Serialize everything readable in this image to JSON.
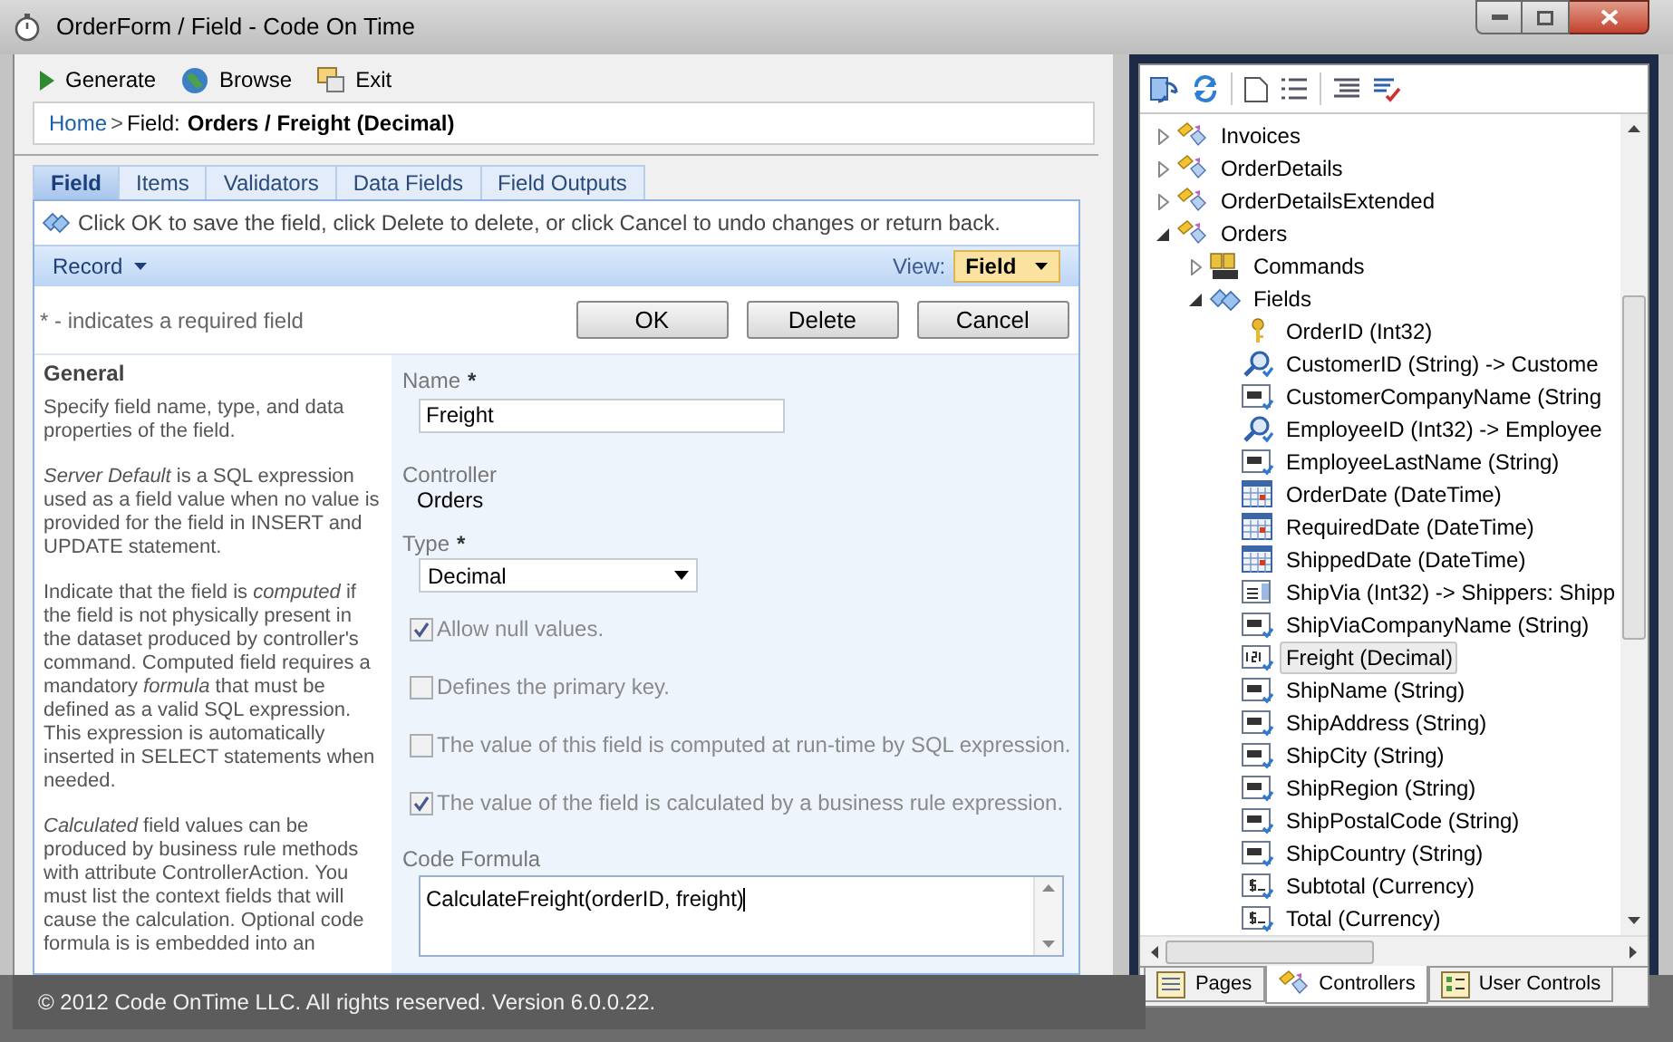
{
  "window": {
    "title": "OrderForm / Field - Code On Time"
  },
  "toolbar": [
    {
      "label": "Generate",
      "kind": "play"
    },
    {
      "label": "Browse",
      "kind": "globe"
    },
    {
      "label": "Exit",
      "kind": "exit"
    }
  ],
  "breadcrumb": {
    "link": "Home",
    "separator": ">",
    "prefix": "Field:",
    "path": "Orders / Freight (Decimal)"
  },
  "tabs": [
    {
      "label": "Field",
      "selected": true
    },
    {
      "label": "Items",
      "selected": false
    },
    {
      "label": "Validators",
      "selected": false
    },
    {
      "label": "Data Fields",
      "selected": false
    },
    {
      "label": "Field Outputs",
      "selected": false
    }
  ],
  "hint": "Click OK to save the field, click Delete to delete, or click Cancel to undo changes or return back.",
  "action_bar": {
    "menu": "Record",
    "view_label": "View:",
    "view": "Field"
  },
  "required_note": "* - indicates a required field",
  "buttons": [
    "OK",
    "Delete",
    "Cancel"
  ],
  "description": {
    "title": "General",
    "paragraphs": [
      "Specify field name, type, and data properties of the field.",
      "*Server Default* is a SQL expression used as a field value when no value is provided for the field in INSERT and UPDATE statement.",
      "Indicate that the field is *computed* if the field is not physically present in the dataset produced by controller's command. Computed field requires a mandatory *formula* that must be defined as a valid SQL expression. This expression is automatically inserted in SELECT statements when needed.",
      "*Calculated* field values can be produced by business rule methods with attribute ControllerAction. You must list the context fields that will cause the calculation. Optional code formula is is embedded into an"
    ]
  },
  "form": [
    {
      "kind": "input",
      "label": "Name",
      "mark": "*",
      "value": "Freight"
    },
    {
      "kind": "static",
      "label": "Controller",
      "value": "Orders"
    },
    {
      "kind": "select",
      "label": "Type",
      "mark": "*",
      "value": "Decimal"
    },
    {
      "kind": "checkbox",
      "label": "Allow null values.",
      "checked": true
    },
    {
      "kind": "checkbox",
      "label": "Defines the primary key.",
      "checked": false
    },
    {
      "kind": "checkbox",
      "label": "The value of this field is computed at run-time by SQL expression.",
      "checked": false
    },
    {
      "kind": "checkbox",
      "label": "The value of the field is calculated by a business rule expression.",
      "checked": true
    },
    {
      "kind": "textarea",
      "label": "Code Formula",
      "value": "CalculateFreight(orderID, freight)"
    }
  ],
  "status_bar": "© 2012 Code OnTime LLC. All rights reserved. Version 6.0.0.22.",
  "tree": [
    {
      "label": "Invoices",
      "kind": "controller",
      "expanded": false
    },
    {
      "label": "OrderDetails",
      "kind": "controller",
      "expanded": false
    },
    {
      "label": "OrderDetailsExtended",
      "kind": "controller",
      "expanded": false
    },
    {
      "label": "Orders",
      "kind": "controller",
      "expanded": true,
      "children": [
        {
          "label": "Commands",
          "kind": "sql",
          "expanded": false
        },
        {
          "label": "Fields",
          "kind": "fields",
          "expanded": true,
          "children": [
            {
              "label": "OrderID (Int32)",
              "kind": "key",
              "selected": false
            },
            {
              "label": "CustomerID (String) -> Custome",
              "kind": "lookup",
              "selected": false
            },
            {
              "label": "CustomerCompanyName (String",
              "kind": "text",
              "selected": false
            },
            {
              "label": "EmployeeID (Int32) -> Employee",
              "kind": "lookup",
              "selected": false
            },
            {
              "label": "EmployeeLastName (String)",
              "kind": "text",
              "selected": false
            },
            {
              "label": "OrderDate (DateTime)",
              "kind": "date",
              "selected": false
            },
            {
              "label": "RequiredDate (DateTime)",
              "kind": "date",
              "selected": false
            },
            {
              "label": "ShippedDate (DateTime)",
              "kind": "date",
              "selected": false
            },
            {
              "label": "ShipVia (Int32) -> Shippers: Shipp",
              "kind": "list",
              "selected": false
            },
            {
              "label": "ShipViaCompanyName (String)",
              "kind": "text",
              "selected": false
            },
            {
              "label": "Freight (Decimal)",
              "kind": "number",
              "selected": true
            },
            {
              "label": "ShipName (String)",
              "kind": "text",
              "selected": false
            },
            {
              "label": "ShipAddress (String)",
              "kind": "text",
              "selected": false
            },
            {
              "label": "ShipCity (String)",
              "kind": "text",
              "selected": false
            },
            {
              "label": "ShipRegion (String)",
              "kind": "text",
              "selected": false
            },
            {
              "label": "ShipPostalCode (String)",
              "kind": "text",
              "selected": false
            },
            {
              "label": "ShipCountry (String)",
              "kind": "text",
              "selected": false
            },
            {
              "label": "Subtotal (Currency)",
              "kind": "currency",
              "selected": false
            },
            {
              "label": "Total (Currency)",
              "kind": "currency",
              "selected": false
            }
          ]
        }
      ]
    }
  ],
  "bottom_tabs": [
    {
      "label": "Pages",
      "kind": "pages",
      "selected": false
    },
    {
      "label": "Controllers",
      "kind": "controllers",
      "selected": true
    },
    {
      "label": "User Controls",
      "kind": "controls",
      "selected": false
    }
  ]
}
